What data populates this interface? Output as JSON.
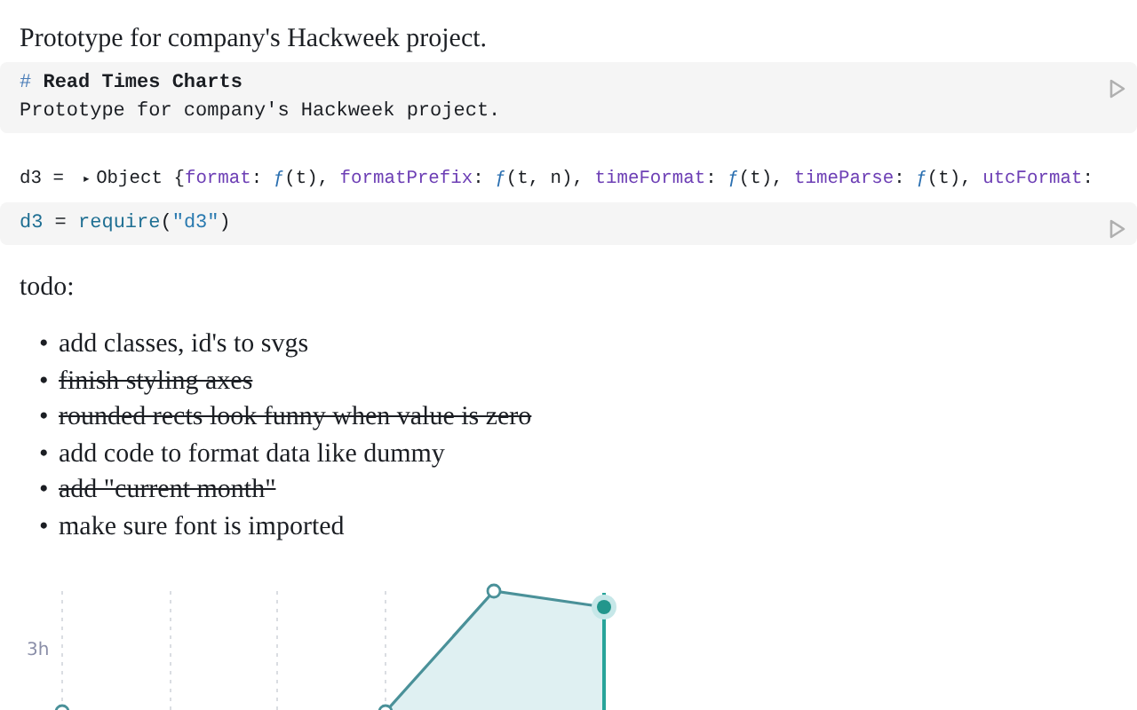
{
  "intro": "Prototype for company's Hackweek project.",
  "cells": [
    {
      "kind": "markdown",
      "heading_mark": "#",
      "heading": "Read Times Charts",
      "body": "Prototype for company's Hackweek project."
    },
    {
      "kind": "code",
      "output": {
        "name": "d3",
        "equals": "=",
        "toggle": "▸",
        "summary": [
          {
            "kind": "plain",
            "text": "Object {"
          },
          {
            "kind": "key",
            "text": "format"
          },
          {
            "kind": "plain",
            "text": ": "
          },
          {
            "kind": "fn",
            "text": "ƒ"
          },
          {
            "kind": "plain",
            "text": "(t), "
          },
          {
            "kind": "key",
            "text": "formatPrefix"
          },
          {
            "kind": "plain",
            "text": ": "
          },
          {
            "kind": "fn",
            "text": "ƒ"
          },
          {
            "kind": "plain",
            "text": "(t, n), "
          },
          {
            "kind": "key",
            "text": "timeFormat"
          },
          {
            "kind": "plain",
            "text": ": "
          },
          {
            "kind": "fn",
            "text": "ƒ"
          },
          {
            "kind": "plain",
            "text": "(t), "
          },
          {
            "kind": "key",
            "text": "timeParse"
          },
          {
            "kind": "plain",
            "text": ": "
          },
          {
            "kind": "fn",
            "text": "ƒ"
          },
          {
            "kind": "plain",
            "text": "(t), "
          },
          {
            "kind": "key",
            "text": "utcFormat"
          },
          {
            "kind": "plain",
            "text": ":"
          }
        ]
      },
      "code": [
        {
          "kind": "name",
          "text": "d3"
        },
        {
          "kind": "plain",
          "text": " = "
        },
        {
          "kind": "fn",
          "text": "require"
        },
        {
          "kind": "plain",
          "text": "("
        },
        {
          "kind": "string",
          "text": "\"d3\""
        },
        {
          "kind": "plain",
          "text": ")"
        }
      ]
    }
  ],
  "todo_title": "todo:",
  "todos": [
    {
      "marker": "•",
      "text": "add classes, id's to svgs",
      "done": false
    },
    {
      "marker": "•",
      "text": "finish styling axes",
      "done": true
    },
    {
      "marker": "•",
      "text": "rounded rects look funny when value is zero",
      "done": true
    },
    {
      "marker": "•",
      "text": "add code to format data like dummy",
      "done": false
    },
    {
      "marker": "•",
      "text": "add \"current month\"",
      "done": true
    },
    {
      "marker": "•",
      "text": "make sure font is imported",
      "done": false
    }
  ],
  "chart": {
    "y_tick_label": "3h"
  }
}
